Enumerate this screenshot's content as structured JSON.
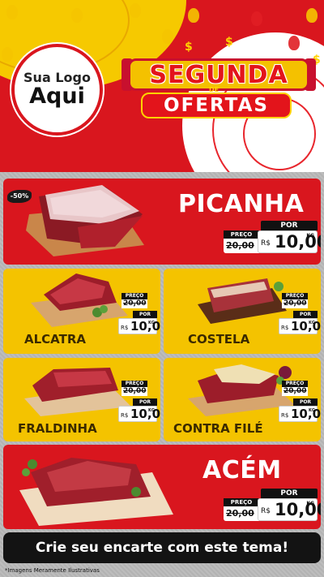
{
  "logo": {
    "line1": "Sua Logo",
    "line2": "Aqui"
  },
  "headline": {
    "top": "SEGUNDA",
    "connector": "DE",
    "bottom": "OFERTAS"
  },
  "colors": {
    "red": "#d9161e",
    "yellow": "#f4c300",
    "black": "#131313"
  },
  "discount_badge": "-50%",
  "labels": {
    "preco": "PREÇO",
    "por": "POR",
    "currency": "R$",
    "unit": "KG"
  },
  "products": [
    {
      "name": "PICANHA",
      "old_price": "20,00",
      "price": "10,00"
    },
    {
      "name": "ALCATRA",
      "old_price": "20,00",
      "price": "10,00"
    },
    {
      "name": "COSTELA",
      "old_price": "20,00",
      "price": "10,00"
    },
    {
      "name": "FRALDINHA",
      "old_price": "20,00",
      "price": "10,00"
    },
    {
      "name": "CONTRA FILÉ",
      "old_price": "20,00",
      "price": "10,00"
    },
    {
      "name": "ACÉM",
      "old_price": "20,00",
      "price": "10,00"
    }
  ],
  "footer": {
    "cta": "Crie seu encarte com este tema!",
    "disclaimer": "*Imagens Meramente Ilustrativas"
  }
}
